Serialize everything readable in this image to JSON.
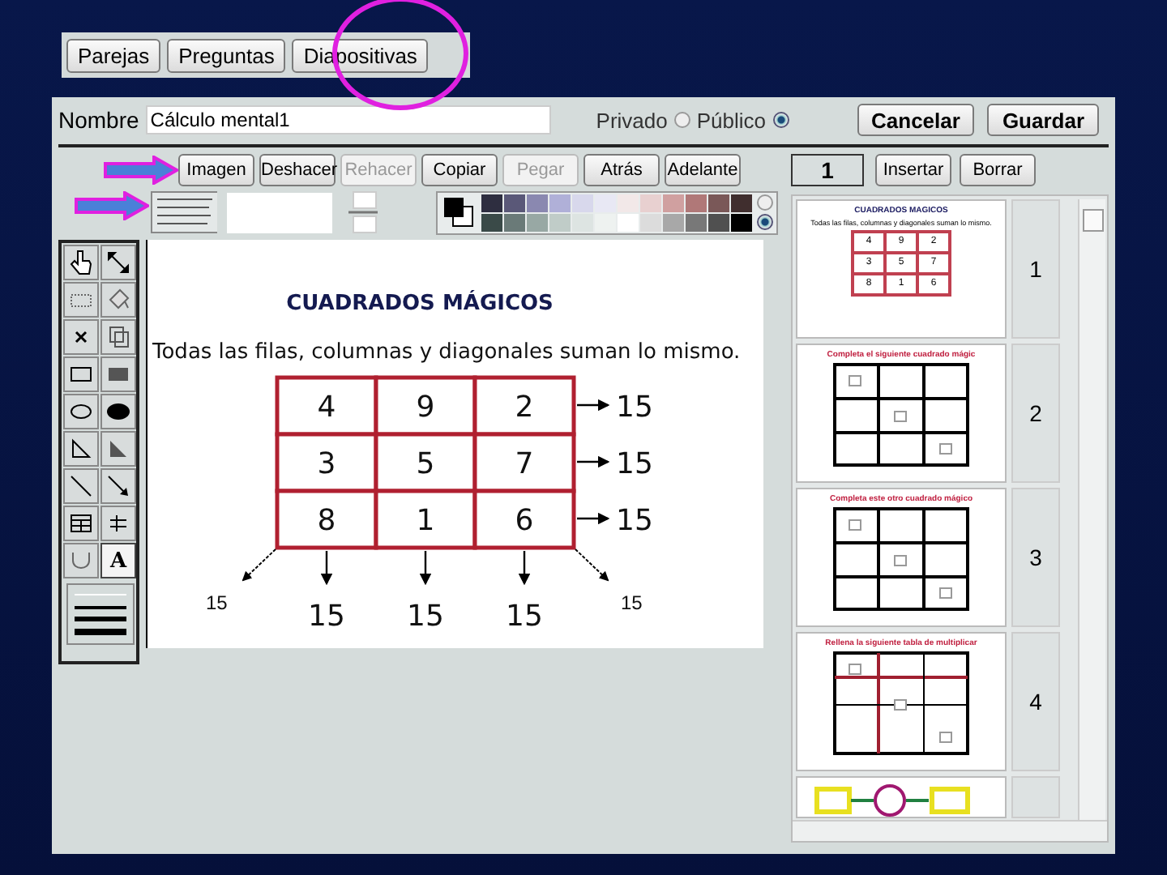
{
  "tabs": [
    "Parejas",
    "Preguntas",
    "Diapositivas"
  ],
  "name_field": {
    "label": "Nombre",
    "value": "Cálculo mental1"
  },
  "visibility": [
    {
      "label": "Privado",
      "selected": false
    },
    {
      "label": "Público",
      "selected": true
    }
  ],
  "actions": [
    "Cancelar",
    "Guardar"
  ],
  "toolbar": [
    {
      "label": "Imagen",
      "disabled": false
    },
    {
      "label": "Deshacer",
      "disabled": false
    },
    {
      "label": "Rehacer",
      "disabled": true
    },
    {
      "label": "Copiar",
      "disabled": false
    },
    {
      "label": "Pegar",
      "disabled": true
    },
    {
      "label": "Atrás",
      "disabled": false
    },
    {
      "label": "Adelante",
      "disabled": false
    }
  ],
  "swatches": [
    {
      "color": "#2e2e40"
    },
    {
      "color": "#5a5878"
    },
    {
      "color": "#8a88b0"
    },
    {
      "color": "#b0b0d8"
    },
    {
      "color": "#d8d8ec"
    },
    {
      "color": "#e8e8f4"
    },
    {
      "color": "#f2e8e8"
    },
    {
      "color": "#e8d0d0"
    },
    {
      "color": "#d0a0a0"
    },
    {
      "color": "#b07878"
    },
    {
      "color": "#7a5858"
    },
    {
      "color": "#402e2e"
    },
    {
      "color": "#3a4a48"
    },
    {
      "color": "#6a7a78"
    },
    {
      "color": "#98a8a4"
    },
    {
      "color": "#c0ccc8"
    },
    {
      "color": "#dde4e2"
    },
    {
      "color": "#eef2f0"
    },
    {
      "color": "#ffffff"
    },
    {
      "color": "#dcdcdc"
    },
    {
      "color": "#a8a8a8"
    },
    {
      "color": "#787878"
    },
    {
      "color": "#505050"
    },
    {
      "color": "#000000"
    }
  ],
  "palette_options": [
    {
      "selected": false
    },
    {
      "selected": true
    }
  ],
  "tools": [
    {
      "kind": "pointer",
      "selected": false
    },
    {
      "kind": "resize",
      "selected": false
    },
    {
      "kind": "select",
      "selected": false
    },
    {
      "kind": "fill",
      "selected": false
    },
    {
      "kind": "delete",
      "selected": false
    },
    {
      "kind": "duplicate",
      "selected": false
    },
    {
      "kind": "rect",
      "selected": false
    },
    {
      "kind": "filled-rect",
      "selected": false
    },
    {
      "kind": "ellipse",
      "selected": false
    },
    {
      "kind": "filled-ellipse",
      "selected": false
    },
    {
      "kind": "triangle",
      "selected": false
    },
    {
      "kind": "filled-triangle",
      "selected": false
    },
    {
      "kind": "line",
      "selected": false
    },
    {
      "kind": "arrow",
      "selected": false
    },
    {
      "kind": "table",
      "selected": false
    },
    {
      "kind": "parallel",
      "selected": false
    },
    {
      "kind": "curve",
      "selected": false
    },
    {
      "kind": "text",
      "label": "A",
      "selected": true
    }
  ],
  "slide": {
    "title": "CUADRADOS MÁGICOS",
    "subtitle": "Todas las filas, columnas y diagonales suman lo mismo.",
    "grid": [
      [
        "4",
        "9",
        "2"
      ],
      [
        "3",
        "5",
        "7"
      ],
      [
        "8",
        "1",
        "6"
      ]
    ],
    "row_sums": [
      "15",
      "15",
      "15"
    ],
    "column_sums": [
      "15",
      "15",
      "15"
    ],
    "diagonal_sums": [
      "15",
      "15"
    ]
  },
  "slide_counter": "1",
  "slide_actions": [
    "Insertar",
    "Borrar"
  ],
  "thumbnails": [
    {
      "number": "1",
      "kind": "sums",
      "title": "CUADRADOS MAGICOS",
      "subtitle": "Todas las filas, columnas y diagonales suman lo mismo.",
      "grid": [
        [
          "4",
          "9",
          "2"
        ],
        [
          "3",
          "5",
          "7"
        ],
        [
          "8",
          "1",
          "6"
        ]
      ]
    },
    {
      "number": "2",
      "kind": "grid",
      "title": "Completa el siguiente cuadrado mágic"
    },
    {
      "number": "3",
      "kind": "grid",
      "title": "Completa este otro cuadrado mágico"
    },
    {
      "number": "4",
      "kind": "table",
      "title": "Rellena la siguiente tabla de multiplicar"
    },
    {
      "kind": "flow"
    }
  ]
}
